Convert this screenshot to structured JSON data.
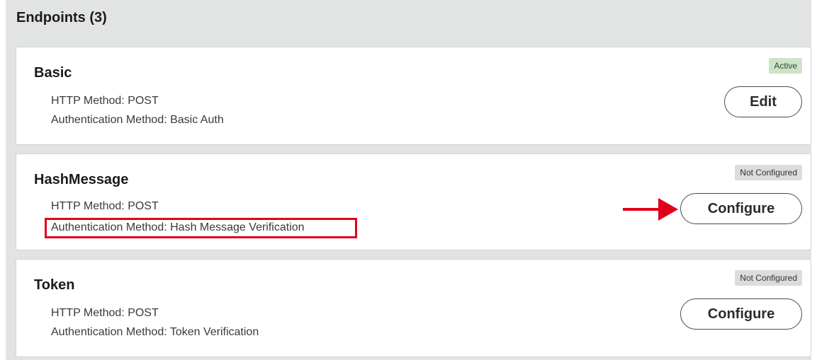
{
  "panel": {
    "title": "Endpoints (3)"
  },
  "endpoints": [
    {
      "name": "Basic",
      "http_method": "HTTP Method: POST",
      "auth_method": "Authentication Method: Basic Auth",
      "status": "Active",
      "action": "Edit"
    },
    {
      "name": "HashMessage",
      "http_method": "HTTP Method: POST",
      "auth_method": "Authentication Method: Hash Message Verification",
      "status": "Not Configured",
      "action": "Configure"
    },
    {
      "name": "Token",
      "http_method": "HTTP Method: POST",
      "auth_method": "Authentication Method: Token Verification",
      "status": "Not Configured",
      "action": "Configure"
    }
  ],
  "annotations": {
    "highlight_color": "#e0001a",
    "arrow_color": "#e0001a"
  }
}
